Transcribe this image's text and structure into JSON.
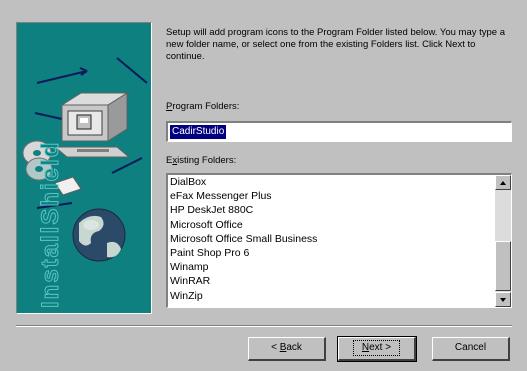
{
  "banner": {
    "vertical_text": "InstallShield",
    "icons": [
      "computer-icon",
      "cd-disc-icon",
      "globe-icon",
      "network-arrows-icon"
    ]
  },
  "description": "Setup will add program icons to the Program Folder listed below. You may type a new folder name, or select one from the existing Folders list.  Click Next to continue.",
  "program_folders": {
    "label_prefix": "",
    "label_access_key": "P",
    "label_rest": "rogram Folders:",
    "value": "CadirStudio"
  },
  "existing_folders": {
    "label_access_key": "x",
    "label_before": "E",
    "label_rest": "isting Folders:",
    "items": [
      "DialBox",
      "eFax Messenger Plus",
      "HP DeskJet 880C",
      "Microsoft Office",
      "Microsoft Office Small Business",
      "Paint Shop Pro 6",
      "Winamp",
      "WinRAR",
      "WinZip"
    ]
  },
  "buttons": {
    "back_prefix": "< ",
    "back_key": "B",
    "back_rest": "ack",
    "next_key": "N",
    "next_rest": "ext >",
    "cancel": "Cancel"
  },
  "colors": {
    "dialog_bg": "#c0c0c0",
    "banner_teal": "#0e8080",
    "selection": "#000080"
  }
}
